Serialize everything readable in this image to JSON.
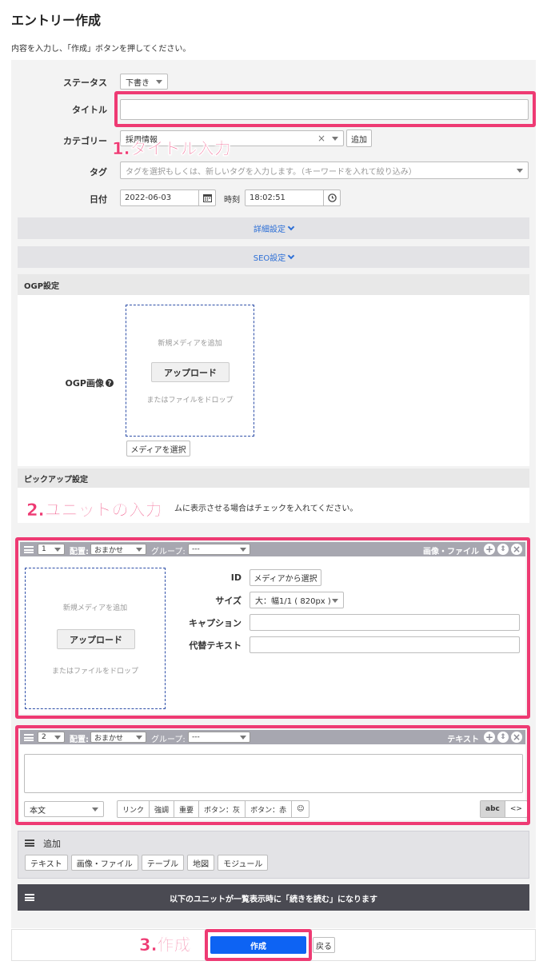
{
  "page": {
    "title": "エントリー作成",
    "description": "内容を入力し、「作成」ボタンを押してください。"
  },
  "form": {
    "status_label": "ステータス",
    "status_value": "下書き",
    "title_label": "タイトル",
    "title_value": "",
    "category_label": "カテゴリー",
    "category_value": "採用情報",
    "category_add": "追加",
    "tag_label": "タグ",
    "tag_placeholder": "タグを選択もしくは、新しいタグを入力します。（キーワードを入れて絞り込み）",
    "date_label": "日付",
    "date_value": "2022-06-03",
    "time_label": "時刻",
    "time_value": "18:02:51"
  },
  "sections": {
    "detail": "詳細設定",
    "seo": "SEO設定",
    "ogp": "OGP設定",
    "ogp_image_label": "OGP画像",
    "pickup": "ピックアップ設定",
    "pickup_text_tail": "ムに表示させる場合はチェックを入れてください。"
  },
  "dropzone": {
    "new_media": "新規メディアを追加",
    "upload": "アップロード",
    "or_drop": "またはファイルをドロップ",
    "select_media": "メディアを選択"
  },
  "unit1": {
    "order": "1",
    "placement_label": "配置:",
    "placement_value": "おまかせ",
    "group_label": "グループ:",
    "group_value": "---",
    "type": "画像・ファイル",
    "id_label": "ID",
    "id_button": "メディアから選択",
    "size_label": "サイズ",
    "size_value": "大：幅1/1 ( 820px )",
    "caption_label": "キャプション",
    "alt_label": "代替テキスト"
  },
  "unit2": {
    "order": "2",
    "placement_label": "配置:",
    "placement_value": "おまかせ",
    "group_label": "グループ:",
    "group_value": "---",
    "type": "テキスト",
    "format": "本文",
    "tools": [
      "リンク",
      "強調",
      "重要",
      "ボタン：灰",
      "ボタン：赤",
      "☺"
    ],
    "abc": "abc",
    "code": "<>"
  },
  "add_bar": {
    "title": "追加",
    "buttons": [
      "テキスト",
      "画像・ファイル",
      "テーブル",
      "地図",
      "モジュール"
    ]
  },
  "more_bar": "以下のユニットが一覧表示時に「続きを読む」になります",
  "footer": {
    "create": "作成",
    "back": "戻る"
  },
  "annotations": {
    "step1": "1.タイトル入力",
    "step2": "2.ユニットの入力",
    "step3": "3.作成"
  },
  "colors": {
    "accent_pink": "#ee3a73",
    "primary_blue": "#0d63f3",
    "link_blue": "#2d6fd6"
  }
}
